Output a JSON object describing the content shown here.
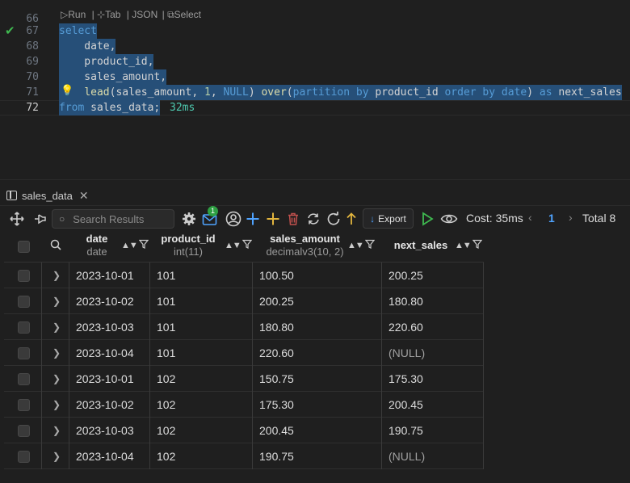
{
  "editor": {
    "top_line_number": "66",
    "codelens": {
      "run": "Run",
      "tab": "Tab",
      "json": "JSON",
      "select": "Select"
    },
    "lines": [
      {
        "number": "67",
        "tokens": [
          {
            "t": "select",
            "c": "kw"
          }
        ]
      },
      {
        "number": "68",
        "tokens": [
          {
            "t": "    date,",
            "c": "id"
          }
        ]
      },
      {
        "number": "69",
        "tokens": [
          {
            "t": "    product_id,",
            "c": "id"
          }
        ]
      },
      {
        "number": "70",
        "tokens": [
          {
            "t": "    sales_amount,",
            "c": "id"
          }
        ]
      },
      {
        "number": "71",
        "tokens": [
          {
            "t": "    ",
            "c": "id"
          },
          {
            "t": "lead",
            "c": "fn"
          },
          {
            "t": "(sales_amount, ",
            "c": "id"
          },
          {
            "t": "1",
            "c": "nm"
          },
          {
            "t": ", ",
            "c": "id"
          },
          {
            "t": "NULL",
            "c": "kw"
          },
          {
            "t": ") ",
            "c": "id"
          },
          {
            "t": "over",
            "c": "fn"
          },
          {
            "t": "(",
            "c": "id"
          },
          {
            "t": "partition by",
            "c": "kw"
          },
          {
            "t": " product_id ",
            "c": "id"
          },
          {
            "t": "order by",
            "c": "kw"
          },
          {
            "t": " ",
            "c": "id"
          },
          {
            "t": "date",
            "c": "kw"
          },
          {
            "t": ") ",
            "c": "id"
          },
          {
            "t": "as",
            "c": "kw"
          },
          {
            "t": " next_sales",
            "c": "id"
          }
        ]
      },
      {
        "number": "72",
        "tokens": [
          {
            "t": "from",
            "c": "kw"
          },
          {
            "t": " sales_data;",
            "c": "id"
          }
        ]
      }
    ],
    "execution_time": "32ms"
  },
  "result_tab": {
    "label": "sales_data"
  },
  "toolbar": {
    "search_placeholder": "Search Results",
    "badge_count": "1",
    "export_label": "Export",
    "cost_label": "Cost: 35ms",
    "page": "1",
    "total_label": "Total 8"
  },
  "colors": {
    "accent": "#4fa3ff",
    "keyword": "#569cd6",
    "function": "#dcdcaa",
    "number": "#b5cea8",
    "success": "#3fb950"
  },
  "grid": {
    "columns": [
      {
        "name": "date",
        "type": "date"
      },
      {
        "name": "product_id",
        "type": "int(11)"
      },
      {
        "name": "sales_amount",
        "type": "decimalv3(10, 2)"
      },
      {
        "name": "next_sales",
        "type": ""
      }
    ],
    "rows": [
      [
        "2023-10-01",
        "101",
        "100.50",
        "200.25"
      ],
      [
        "2023-10-02",
        "101",
        "200.25",
        "180.80"
      ],
      [
        "2023-10-03",
        "101",
        "180.80",
        "220.60"
      ],
      [
        "2023-10-04",
        "101",
        "220.60",
        "(NULL)"
      ],
      [
        "2023-10-01",
        "102",
        "150.75",
        "175.30"
      ],
      [
        "2023-10-02",
        "102",
        "175.30",
        "200.45"
      ],
      [
        "2023-10-03",
        "102",
        "200.45",
        "190.75"
      ],
      [
        "2023-10-04",
        "102",
        "190.75",
        "(NULL)"
      ]
    ]
  }
}
